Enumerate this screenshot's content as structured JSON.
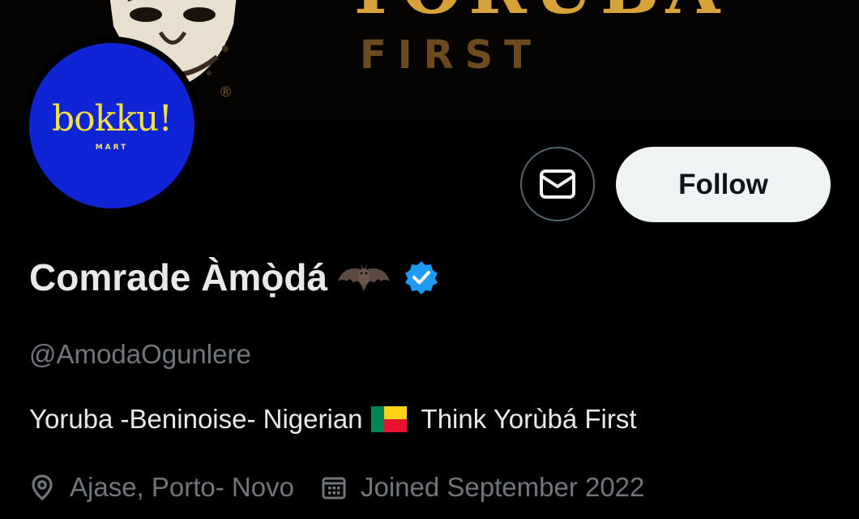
{
  "banner": {
    "logo_big": "YORUBA",
    "logo_small": "FIRST",
    "registered_mark": "®"
  },
  "avatar": {
    "brand": "bokku!",
    "sub": "MART",
    "background_color": "#0f24d4",
    "text_color": "#f2df42"
  },
  "actions": {
    "message_icon": "envelope-icon",
    "follow_label": "Follow"
  },
  "profile": {
    "display_name": "Comrade Àmọ̀dá",
    "name_emoji": "bat-icon",
    "verified_icon": "verified-badge-icon",
    "verified_color": "#1d9bf0",
    "handle": "@AmodaOgunlere",
    "bio_before_flag": "Yoruba -Beninoise- Nigerian",
    "bio_flag": "benin-flag-icon",
    "bio_after_flag": "Think Yorùbá First",
    "location_icon": "location-pin-icon",
    "location": "Ajase, Porto- Novo",
    "joined_icon": "calendar-icon",
    "joined": "Joined September 2022"
  },
  "theme": {
    "background": "#000000",
    "primary_text": "#e7e9ea",
    "secondary_text": "#71767b",
    "follow_button_bg": "#eff3f4"
  }
}
